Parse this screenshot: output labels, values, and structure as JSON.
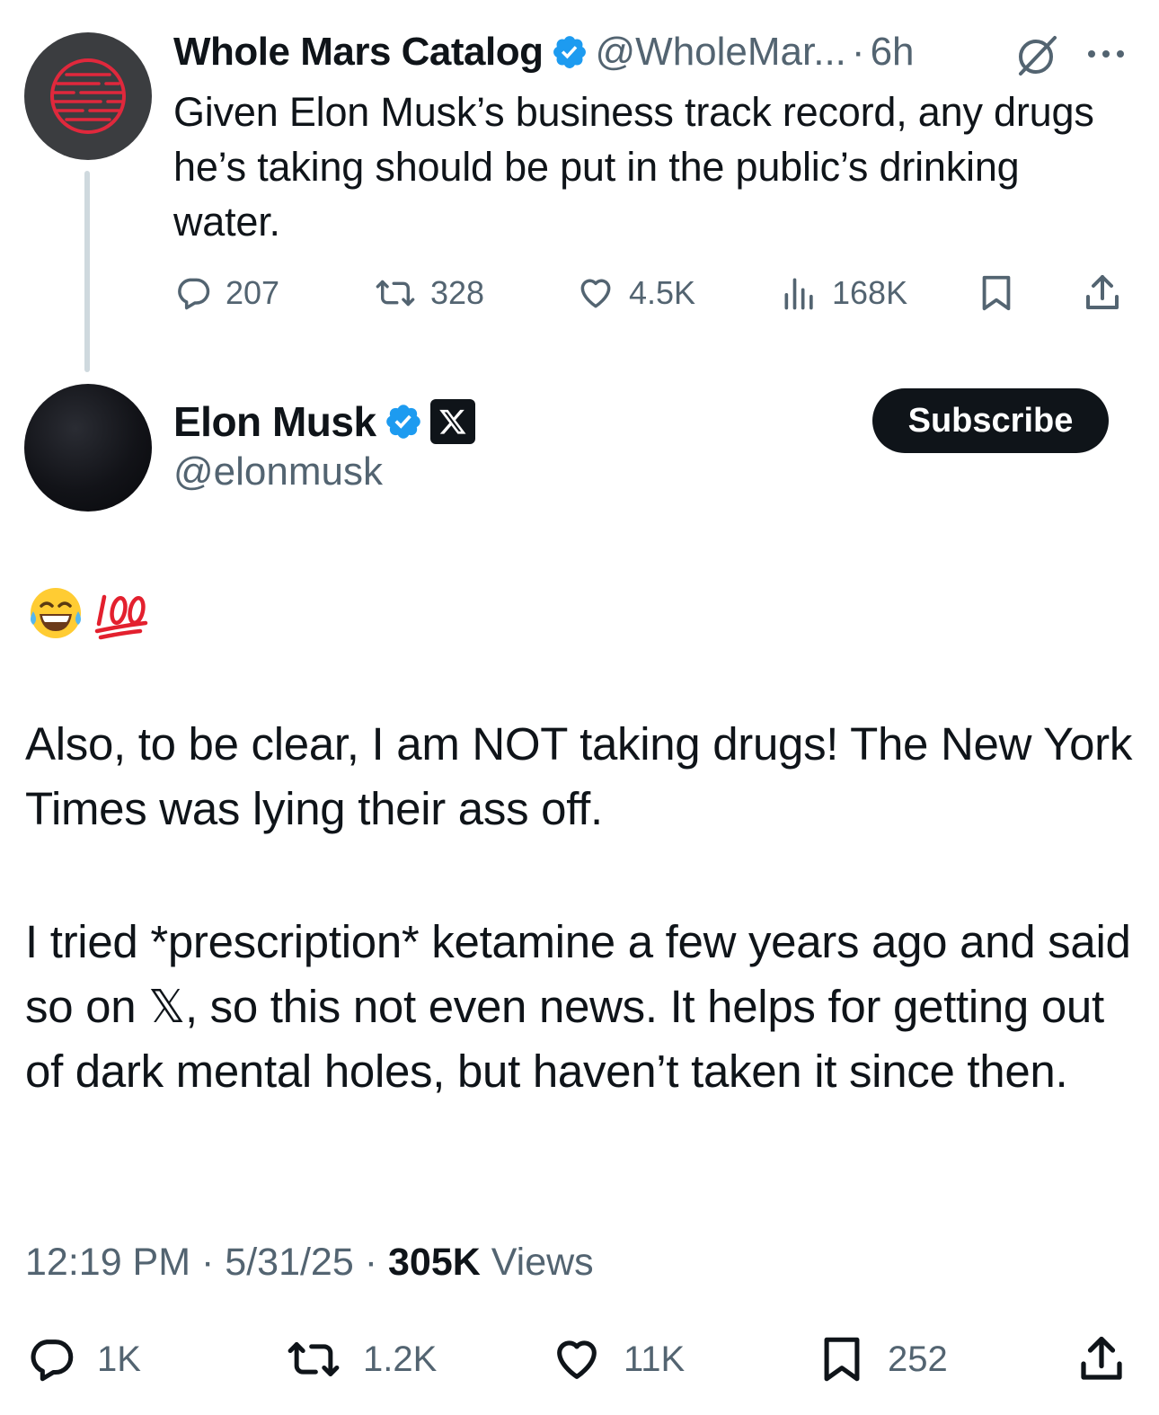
{
  "parent_tweet": {
    "display_name": "Whole Mars Catalog",
    "handle": "@WholeMar...",
    "separator": "·",
    "time": "6h",
    "text": "Given Elon Musk’s business track record, any drugs he’s taking should be put in the public’s drinking water.",
    "stats": {
      "replies": "207",
      "reposts": "328",
      "likes": "4.5K",
      "views": "168K"
    },
    "icons": {
      "verified": "verified-badge-icon",
      "grok": "grok-icon",
      "more": "more-icon"
    }
  },
  "main_tweet": {
    "display_name": "Elon Musk",
    "handle": "@elonmusk",
    "subscribe_label": "Subscribe",
    "emojis": "😂💯",
    "paragraph_1": "Also, to be clear, I am NOT taking drugs! The New York Times was lying their ass off.",
    "paragraph_2_before_x": "I tried *prescription* ketamine a few years ago and said so on ",
    "paragraph_2_x": "𝕏",
    "paragraph_2_after_x": ", so this not even news. It helps for getting out of dark mental holes, but haven’t taken it since then.",
    "time": "12:19 PM",
    "separator": "·",
    "date": "5/31/25",
    "view_count": "305K",
    "views_label": "Views",
    "stats": {
      "replies": "1K",
      "reposts": "1.2K",
      "likes": "11K",
      "bookmarks": "252"
    }
  },
  "colors": {
    "text": "#0f1419",
    "secondary": "#536471",
    "verified": "#1d9bf0",
    "thread_line": "#cfd9de",
    "avatar_accent": "#e0283c"
  }
}
